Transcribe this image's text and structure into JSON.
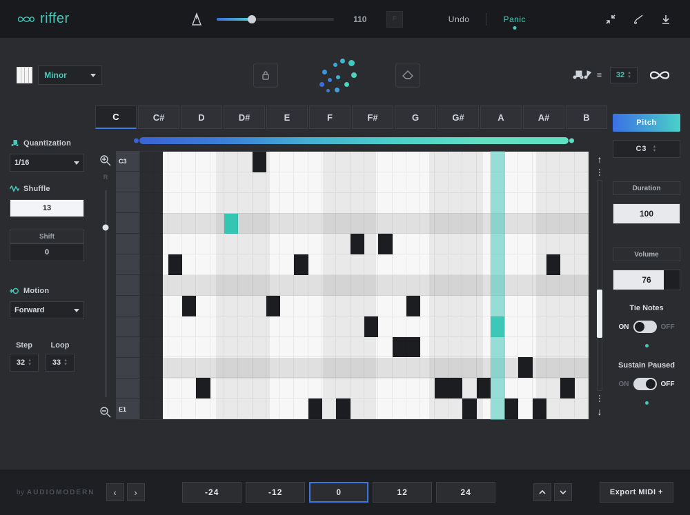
{
  "brand": "riffer",
  "top": {
    "tempo_value": "110",
    "undo": "Undo",
    "panic": "Panic",
    "sync_letter": "F"
  },
  "row2": {
    "scale": "Minor",
    "rate_eq": "=",
    "steps": "32"
  },
  "left": {
    "quantization_label": "Quantization",
    "quantization_value": "1/16",
    "shuffle_label": "Shuffle",
    "shuffle_value": "13",
    "shift_label": "Shift",
    "shift_value": "0",
    "motion_label": "Motion",
    "motion_value": "Forward",
    "step_label": "Step",
    "step_value": "32",
    "loop_label": "Loop",
    "loop_value": "33"
  },
  "tabs": [
    "C",
    "C#",
    "D",
    "D#",
    "E",
    "F",
    "F#",
    "G",
    "G#",
    "A",
    "A#",
    "B"
  ],
  "active_tab": 0,
  "row_top_label": "C3",
  "row_bottom_label": "E1",
  "playhead_col": 25,
  "notes": [
    {
      "r": 0,
      "c": 8
    },
    {
      "r": 3,
      "c": 6,
      "teal": true
    },
    {
      "r": 4,
      "c": 15
    },
    {
      "r": 4,
      "c": 17
    },
    {
      "r": 5,
      "c": 2
    },
    {
      "r": 5,
      "c": 11
    },
    {
      "r": 5,
      "c": 29
    },
    {
      "r": 7,
      "c": 3
    },
    {
      "r": 7,
      "c": 9
    },
    {
      "r": 7,
      "c": 19
    },
    {
      "r": 8,
      "c": 16
    },
    {
      "r": 8,
      "c": 25,
      "teal": true
    },
    {
      "r": 9,
      "c": 18
    },
    {
      "r": 9,
      "c": 19
    },
    {
      "r": 10,
      "c": 27
    },
    {
      "r": 11,
      "c": 4
    },
    {
      "r": 11,
      "c": 21
    },
    {
      "r": 11,
      "c": 22
    },
    {
      "r": 11,
      "c": 24
    },
    {
      "r": 11,
      "c": 30
    },
    {
      "r": 12,
      "c": 12
    },
    {
      "r": 12,
      "c": 14
    },
    {
      "r": 12,
      "c": 23
    },
    {
      "r": 12,
      "c": 26
    },
    {
      "r": 12,
      "c": 28
    }
  ],
  "dark_rows": [
    3,
    6,
    10
  ],
  "right": {
    "pitch_label": "Pitch",
    "pitch_value": "C3",
    "duration_label": "Duration",
    "duration_value": "100",
    "volume_label": "Volume",
    "volume_value": "76",
    "tie_label": "Tie Notes",
    "sustain_label": "Sustain Paused",
    "on": "ON",
    "off": "OFF"
  },
  "bottom": {
    "brand_line_prefix": "by",
    "brand_line": "AUDIOMODERN",
    "transpose": [
      "-24",
      "-12",
      "0",
      "+12",
      "+24"
    ],
    "transpose_display": [
      "-24",
      "-12",
      "0",
      "12",
      "24"
    ],
    "active_transpose": 2,
    "export": "Export MIDI +"
  }
}
